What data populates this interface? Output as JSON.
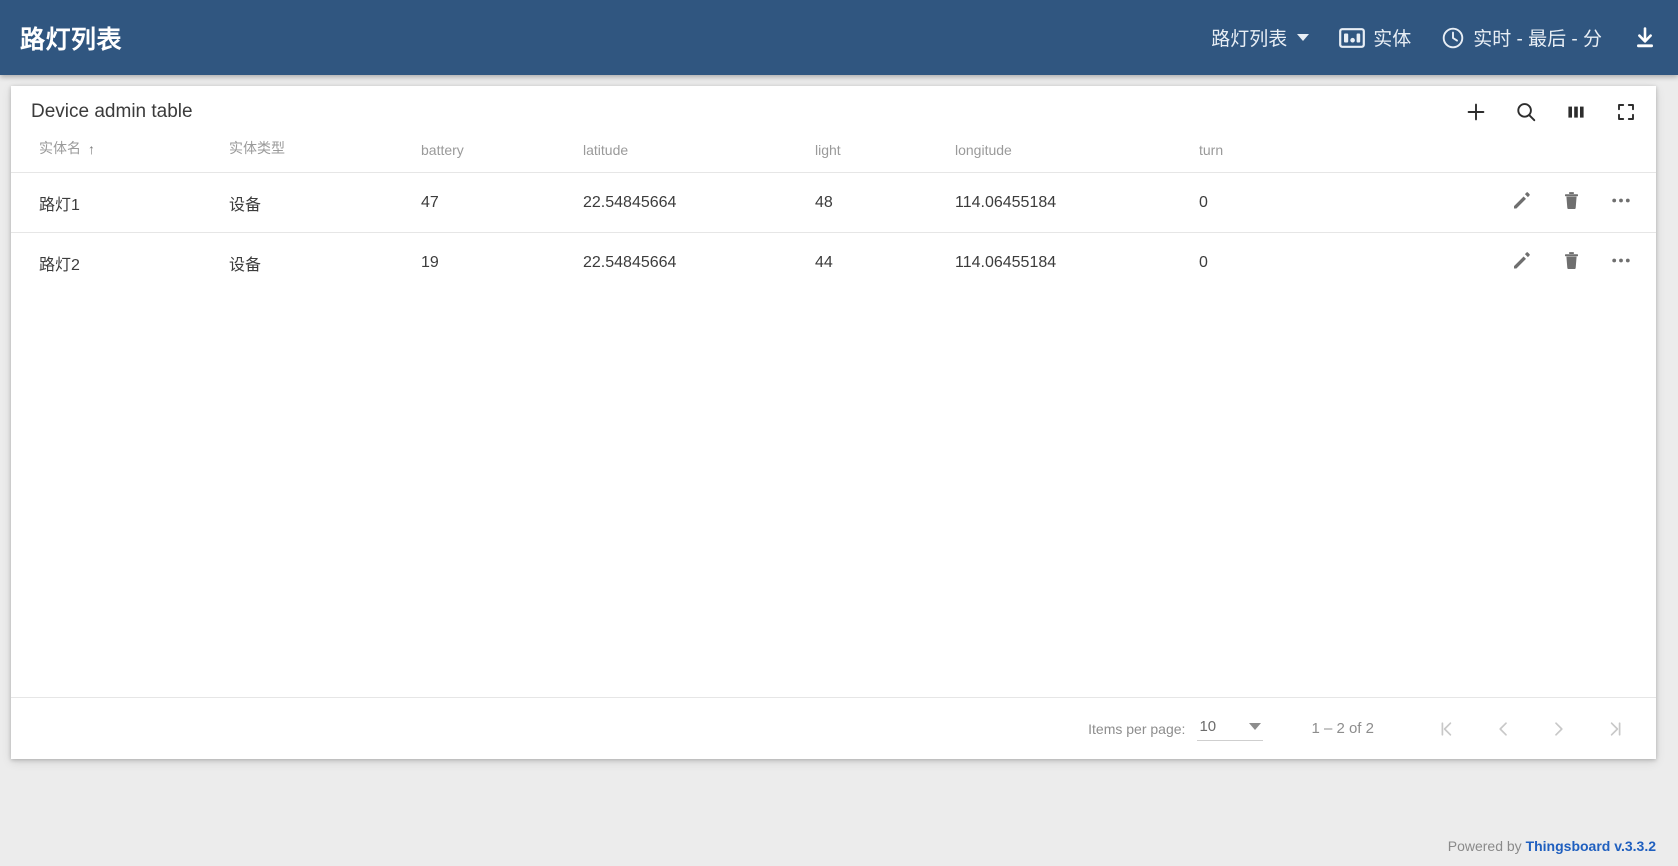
{
  "topbar": {
    "dashboard_title": "路灯列表",
    "state_selector": {
      "label": "路灯列表",
      "icon": "chevron-down-icon"
    },
    "entity_button": {
      "label": "实体",
      "icon": "entity-dashboard-icon"
    },
    "time_button": {
      "label": "实时 - 最后 - 分",
      "icon": "clock-icon"
    },
    "export_button": {
      "icon": "download-icon"
    },
    "background_color": "#305680"
  },
  "widget": {
    "title": "Device admin table",
    "tools": [
      {
        "name": "add-entity-button",
        "icon": "plus-icon"
      },
      {
        "name": "search-button",
        "icon": "search-icon"
      },
      {
        "name": "column-display-button",
        "icon": "columns-icon"
      },
      {
        "name": "fullscreen-button",
        "icon": "fullscreen-icon"
      }
    ]
  },
  "table": {
    "columns": [
      {
        "key": "name",
        "label": "实体名",
        "sorted": "asc",
        "sort_glyph": "↑"
      },
      {
        "key": "type",
        "label": "实体类型"
      },
      {
        "key": "battery",
        "label": "battery"
      },
      {
        "key": "latitude",
        "label": "latitude"
      },
      {
        "key": "light",
        "label": "light"
      },
      {
        "key": "longitude",
        "label": "longitude"
      },
      {
        "key": "turn",
        "label": "turn"
      },
      {
        "key": "actions",
        "label": ""
      }
    ],
    "rows": [
      {
        "name": "路灯1",
        "type": "设备",
        "battery": "47",
        "latitude": "22.54845664",
        "light": "48",
        "longitude": "114.06455184",
        "turn": "0"
      },
      {
        "name": "路灯2",
        "type": "设备",
        "battery": "19",
        "latitude": "22.54845664",
        "light": "44",
        "longitude": "114.06455184",
        "turn": "0"
      }
    ],
    "row_actions": [
      {
        "name": "edit-row-button",
        "icon": "pencil-icon"
      },
      {
        "name": "delete-row-button",
        "icon": "trash-icon"
      },
      {
        "name": "more-actions-button",
        "icon": "ellipsis-icon"
      }
    ]
  },
  "paginator": {
    "items_per_page_label": "Items per page:",
    "items_per_page_value": "10",
    "range_label": "1 – 2 of 2",
    "buttons": [
      {
        "name": "first-page-button",
        "glyph": "|<"
      },
      {
        "name": "previous-page-button",
        "glyph": "<"
      },
      {
        "name": "next-page-button",
        "glyph": ">"
      },
      {
        "name": "last-page-button",
        "glyph": ">|"
      }
    ]
  },
  "footer": {
    "prefix": "Powered by ",
    "link_text": "Thingsboard v.3.3.2",
    "link_color": "#1f5fbf"
  }
}
